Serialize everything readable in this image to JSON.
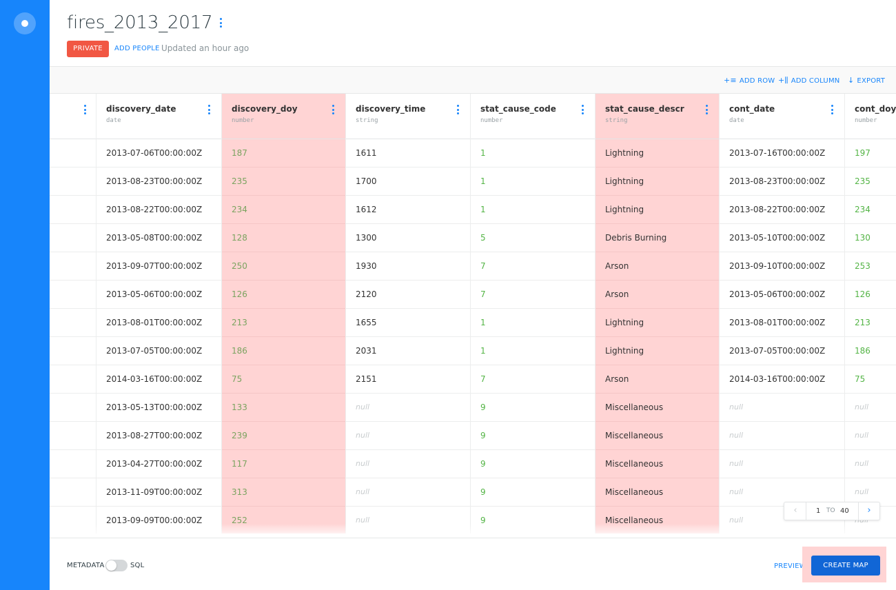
{
  "dataset": {
    "title": "fires_2013_2017",
    "privacy": "PRIVATE",
    "add_people": "ADD PEOPLE",
    "updated": "Updated an hour ago"
  },
  "toolbar": {
    "add_row": "ADD ROW",
    "add_column": "ADD COLUMN",
    "export": "EXPORT"
  },
  "columns": [
    {
      "name": "discovery_date",
      "type": "date"
    },
    {
      "name": "discovery_doy",
      "type": "number"
    },
    {
      "name": "discovery_time",
      "type": "string"
    },
    {
      "name": "stat_cause_code",
      "type": "number"
    },
    {
      "name": "stat_cause_descr",
      "type": "string"
    },
    {
      "name": "cont_date",
      "type": "date"
    },
    {
      "name": "cont_doy",
      "type": "number"
    }
  ],
  "rows": [
    [
      "2013-07-06T00:00:00Z",
      "187",
      "1611",
      "1",
      "Lightning",
      "2013-07-16T00:00:00Z",
      "197"
    ],
    [
      "2013-08-23T00:00:00Z",
      "235",
      "1700",
      "1",
      "Lightning",
      "2013-08-23T00:00:00Z",
      "235"
    ],
    [
      "2013-08-22T00:00:00Z",
      "234",
      "1612",
      "1",
      "Lightning",
      "2013-08-22T00:00:00Z",
      "234"
    ],
    [
      "2013-05-08T00:00:00Z",
      "128",
      "1300",
      "5",
      "Debris Burning",
      "2013-05-10T00:00:00Z",
      "130"
    ],
    [
      "2013-09-07T00:00:00Z",
      "250",
      "1930",
      "7",
      "Arson",
      "2013-09-10T00:00:00Z",
      "253"
    ],
    [
      "2013-05-06T00:00:00Z",
      "126",
      "2120",
      "7",
      "Arson",
      "2013-05-06T00:00:00Z",
      "126"
    ],
    [
      "2013-08-01T00:00:00Z",
      "213",
      "1655",
      "1",
      "Lightning",
      "2013-08-01T00:00:00Z",
      "213"
    ],
    [
      "2013-07-05T00:00:00Z",
      "186",
      "2031",
      "1",
      "Lightning",
      "2013-07-05T00:00:00Z",
      "186"
    ],
    [
      "2014-03-16T00:00:00Z",
      "75",
      "2151",
      "7",
      "Arson",
      "2014-03-16T00:00:00Z",
      "75"
    ],
    [
      "2013-05-13T00:00:00Z",
      "133",
      "null",
      "9",
      "Miscellaneous",
      "null",
      "null"
    ],
    [
      "2013-08-27T00:00:00Z",
      "239",
      "null",
      "9",
      "Miscellaneous",
      "null",
      "null"
    ],
    [
      "2013-04-27T00:00:00Z",
      "117",
      "null",
      "9",
      "Miscellaneous",
      "null",
      "null"
    ],
    [
      "2013-11-09T00:00:00Z",
      "313",
      "null",
      "9",
      "Miscellaneous",
      "null",
      "null"
    ],
    [
      "2013-09-09T00:00:00Z",
      "252",
      "null",
      "9",
      "Miscellaneous",
      "null",
      "null"
    ]
  ],
  "pagination": {
    "from": "1",
    "to_label": "TO",
    "total": "40"
  },
  "footer": {
    "metadata_label": "METADATA",
    "sql_label": "SQL",
    "preview": "PREVIEW",
    "create_map": "CREATE MAP"
  },
  "colors": {
    "sidebar": "#1785fb",
    "accent": "#1785fb",
    "privacy_badge": "#f15743",
    "highlight": "#ffd4d4",
    "number_text": "#53b445",
    "create_map_button": "#1166d6"
  }
}
